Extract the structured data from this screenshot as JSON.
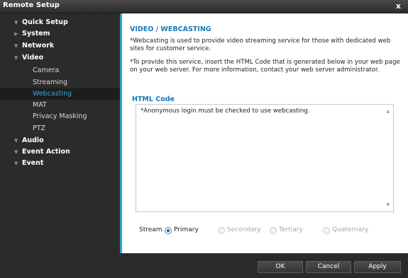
{
  "window": {
    "title": "Remote Setup",
    "close_glyph": "x"
  },
  "sidebar": {
    "items": [
      {
        "label": "Quick Setup",
        "level": "top",
        "arrow": "▼"
      },
      {
        "label": "System",
        "level": "top",
        "arrow": "▶"
      },
      {
        "label": "Network",
        "level": "top",
        "arrow": "▼"
      },
      {
        "label": "Video",
        "level": "top",
        "arrow": "▼"
      },
      {
        "label": "Camera",
        "level": "sub"
      },
      {
        "label": "Streaming",
        "level": "sub"
      },
      {
        "label": "Webcasting",
        "level": "sub",
        "active": true
      },
      {
        "label": "MAT",
        "level": "sub"
      },
      {
        "label": "Privacy Masking",
        "level": "sub"
      },
      {
        "label": "PTZ",
        "level": "sub"
      },
      {
        "label": "Audio",
        "level": "top",
        "arrow": "▼"
      },
      {
        "label": "Event Action",
        "level": "top",
        "arrow": "▼"
      },
      {
        "label": "Event",
        "level": "top",
        "arrow": "▼"
      }
    ]
  },
  "content": {
    "heading": "VIDEO / WEBCASTING",
    "desc1": "*Webcasting is used to provide video streaming service for those with dedicated web sites for customer service.",
    "desc2": "*To provide this service, insert the HTML Code that is generated  below in your web page on your web server. For more information, contact your web server administrator.",
    "html_code_label": "HTML Code",
    "html_code_text": "*Anonymous login must be checked to use webcasting.",
    "stream_label": "Stream",
    "stream_options": [
      {
        "label": "Primary",
        "selected": true,
        "enabled": true
      },
      {
        "label": "Secondary",
        "selected": false,
        "enabled": false
      },
      {
        "label": "Tertiary",
        "selected": false,
        "enabled": false
      },
      {
        "label": "Quaternary",
        "selected": false,
        "enabled": false
      }
    ]
  },
  "footer": {
    "ok": "OK",
    "cancel": "Cancel",
    "apply": "Apply"
  },
  "colors": {
    "accent": "#2e9fd0",
    "heading": "#1a78b4",
    "active_item": "#3aa6d8"
  }
}
